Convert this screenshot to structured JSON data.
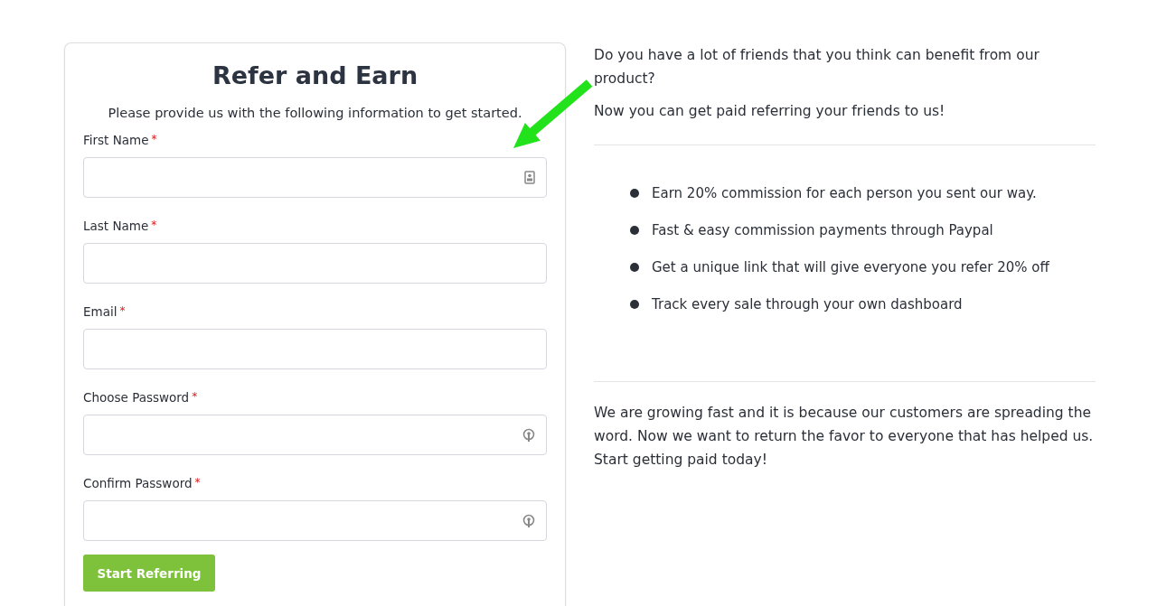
{
  "form": {
    "title": "Refer and Earn",
    "subtitle": "Please provide us with the following information to get started.",
    "fields": [
      {
        "label": "First Name",
        "required_mark": "*",
        "kind": "contact"
      },
      {
        "label": "Last Name",
        "required_mark": "*",
        "kind": "plain"
      },
      {
        "label": "Email",
        "required_mark": "*",
        "kind": "plain"
      },
      {
        "label": "Choose Password",
        "required_mark": "*",
        "kind": "password"
      },
      {
        "label": "Confirm Password",
        "required_mark": "*",
        "kind": "password"
      }
    ],
    "submit": "Start Referring"
  },
  "intro": [
    "Do you have a lot of friends that you think can benefit from our product?",
    "Now you can get paid referring your friends to us!"
  ],
  "benefits": [
    "Earn 20% commission for each person you sent our way.",
    "Fast & easy commission payments through Paypal",
    "Get a unique link that will give everyone you refer 20% off",
    "Track every sale through your own dashboard"
  ],
  "closing": "We are growing fast and it is because our customers are spreading the word. Now we want to return the favor to everyone that has helped us. Start getting paid today!"
}
